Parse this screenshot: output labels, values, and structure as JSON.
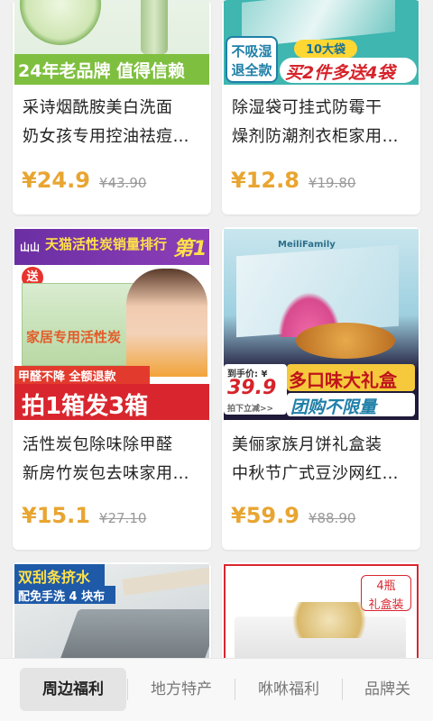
{
  "cards": [
    {
      "image_banner": "24年老品牌 值得信赖",
      "title_line1": "采诗烟酰胺美白洗面",
      "title_line2": "奶女孩专用控油祛痘…",
      "price": "¥24.9",
      "original_price": "¥43.90"
    },
    {
      "image_badge1": "不吸湿",
      "image_badge2": "退全款",
      "image_banner": "买2件多送4袋",
      "image_tag": "10大袋",
      "title_line1": "除湿袋可挂式防霉干",
      "title_line2": "燥剂防潮剂衣柜家用…",
      "price": "¥12.8",
      "original_price": "¥19.80"
    },
    {
      "image_top": "天猫活性炭销量排行",
      "image_rank": "第1",
      "image_brand": "山山",
      "image_send": "送",
      "image_mid": "家居专用活性炭",
      "image_formaldehyde": "甲醛不降 全额退款",
      "image_banner": "拍1箱发3箱",
      "title_line1": "活性炭包除味除甲醛",
      "title_line2": "新房竹炭包去味家用…",
      "price": "¥15.1",
      "original_price": "¥27.10"
    },
    {
      "image_brand": "MeiliFamily",
      "image_price_tag": "到手价: ¥",
      "image_price": "39.9",
      "image_down": "拍下立减>>",
      "image_banner": "多口味大礼盒",
      "image_sub": "团购不限量",
      "title_line1": "美俪家族月饼礼盒装",
      "title_line2": "中秋节广式豆沙网红…",
      "price": "¥59.9",
      "original_price": "¥88.90"
    },
    {
      "image_banner": "双刮条挤水",
      "image_sub": "配免手洗 4 块布"
    },
    {
      "image_tag": "4瓶\n礼盒装"
    }
  ],
  "tabs": [
    {
      "label": "周边福利",
      "active": true
    },
    {
      "label": "地方特产",
      "active": false
    },
    {
      "label": "咻咻福利",
      "active": false
    },
    {
      "label": "品牌关",
      "active": false
    }
  ]
}
